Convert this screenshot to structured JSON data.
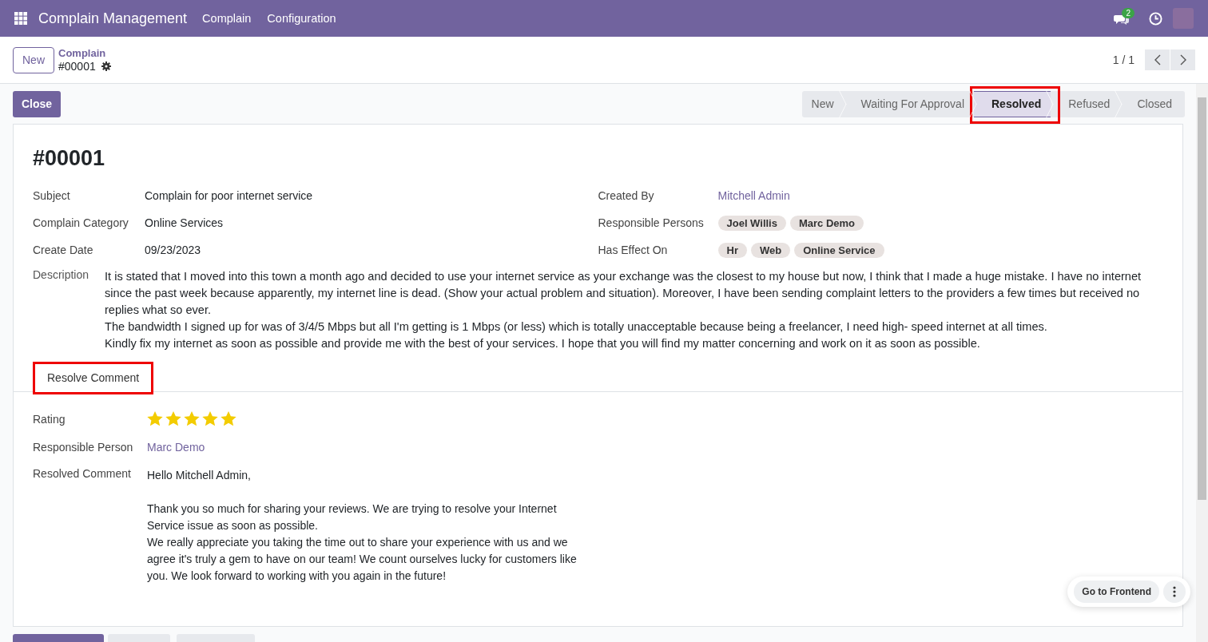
{
  "navbar": {
    "app_title": "Complain Management",
    "menus": [
      "Complain",
      "Configuration"
    ],
    "message_count": "2"
  },
  "control_panel": {
    "new_button": "New",
    "breadcrumb": "Complain",
    "record": "#00001",
    "pager": "1 / 1"
  },
  "close_button": "Close",
  "stages": [
    {
      "label": "New",
      "selected": false,
      "highlighted": false
    },
    {
      "label": "Waiting For Approval",
      "selected": false,
      "highlighted": false
    },
    {
      "label": "Resolved",
      "selected": true,
      "highlighted": true
    },
    {
      "label": "Refused",
      "selected": false,
      "highlighted": false
    },
    {
      "label": "Closed",
      "selected": false,
      "highlighted": false
    }
  ],
  "form": {
    "title": "#00001",
    "left_fields": [
      {
        "label": "Subject",
        "value": "Complain for poor internet service"
      },
      {
        "label": "Complain Category",
        "value": "Online Services"
      },
      {
        "label": "Create Date",
        "value": "09/23/2023"
      }
    ],
    "right_fields": [
      {
        "label": "Created By",
        "kind": "link",
        "value": "Mitchell Admin"
      },
      {
        "label": "Responsible Persons",
        "kind": "tags",
        "tags": [
          "Joel Willis",
          "Marc Demo"
        ]
      },
      {
        "label": "Has Effect On",
        "kind": "tags",
        "tags": [
          "Hr",
          "Web",
          "Online Service"
        ]
      }
    ],
    "description_label": "Description",
    "description": [
      "It is stated that I moved into this town a month ago and decided to use your internet service as your exchange was the closest to my house but now, I think that I made a huge mistake. I have no internet since the past week because apparently, my internet line is dead. (Show your actual problem and situation). Moreover, I have been sending complaint letters to the providers a few times but received no replies what so ever.",
      "The bandwidth I signed up for was of 3/4/5 Mbps but all I'm getting is 1 Mbps (or less) which is totally unacceptable because being a freelancer, I need high- speed internet at all times.",
      "Kindly fix my internet as soon as possible and provide me with the best of your services. I hope that you will find my matter concerning and work on it as soon as possible."
    ],
    "tabs": [
      {
        "label": "Resolve Comment",
        "selected": true,
        "highlighted": true
      }
    ],
    "rating_label": "Rating",
    "rating": {
      "stars": 5
    },
    "responsible_label": "Responsible Person",
    "responsible": "Marc Demo",
    "comment_label": "Resolved Comment",
    "comment": {
      "greeting": "Hello Mitchell Admin,",
      "paragraphs": [
        "Thank you so much for sharing your reviews. We are trying to resolve your Internet Service issue as soon as possible.",
        "We really appreciate you taking the time out to share your experience with us and we agree it's truly a gem to have on our team! We count ourselves lucky for customers like you. We look forward to working with you again in the future!"
      ]
    }
  },
  "frontend_button": "Go to Frontend"
}
